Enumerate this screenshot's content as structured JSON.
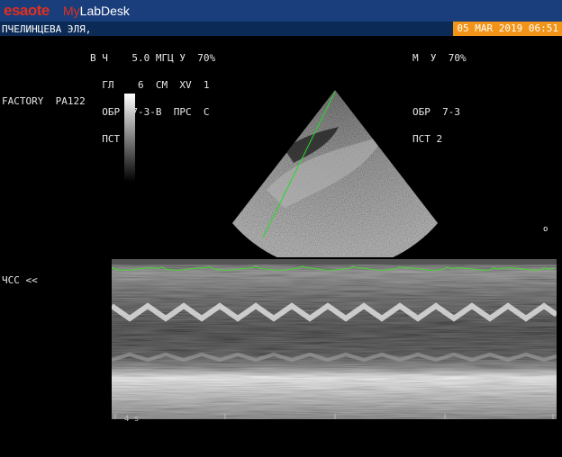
{
  "header": {
    "brand_logo": "esaote",
    "brand_product_my": "My",
    "brand_product_rest": "LabDesk",
    "patient_name": "ПЧЕЛИНЦЕВА ЭЛЯ,",
    "datetime": "05 MAR 2019 06:51"
  },
  "left_params": {
    "line1": "В Ч    5.0 МГЦ У  70%",
    "line2": "  ГЛ    6  СМ  XV  1",
    "line3": "  ОБР  7-3-В  ПРС  С",
    "line4": "  ПСТ 2"
  },
  "right_params": {
    "line1": "М  У  70%",
    "line2": "",
    "line3": "ОБР  7-3",
    "line4": "ПСТ 2"
  },
  "probe_label": "FACTORY  PA122",
  "heart_rate_label": "ЧСС <<",
  "side_marker": "o",
  "scale_label": "4 s",
  "colors": {
    "topbar": "#1a3d7c",
    "datetime_bg": "#f29418",
    "brand_red": "#e0301e",
    "ecg_trace": "#4cd636",
    "m_line": "#22dd22"
  }
}
